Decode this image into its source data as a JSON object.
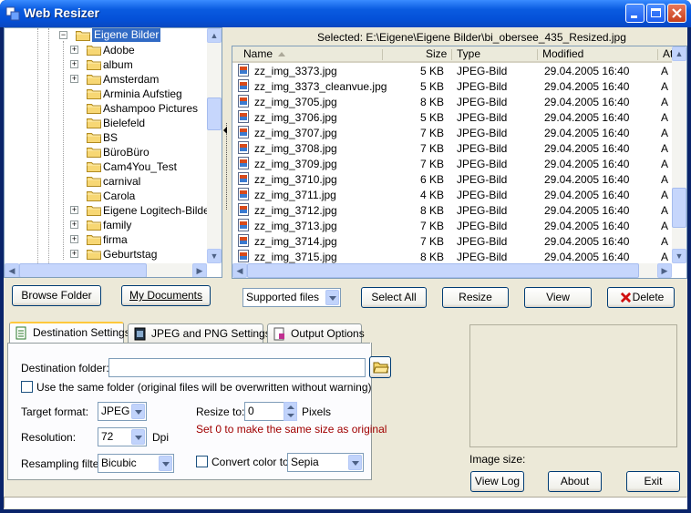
{
  "window": {
    "title": "Web Resizer"
  },
  "selected_path": "Selected: E:\\Eigene\\Eigene Bilder\\bi_obersee_435_Resized.jpg",
  "tree": {
    "items": [
      {
        "label": "Eigene Bilder",
        "expander": "−",
        "selected": true
      },
      {
        "label": "Adobe",
        "expander": "+"
      },
      {
        "label": "album",
        "expander": "+"
      },
      {
        "label": "Amsterdam",
        "expander": "+"
      },
      {
        "label": "Arminia Aufstieg",
        "expander": ""
      },
      {
        "label": "Ashampoo Pictures",
        "expander": ""
      },
      {
        "label": "Bielefeld",
        "expander": ""
      },
      {
        "label": "BS",
        "expander": ""
      },
      {
        "label": "BüroBüro",
        "expander": ""
      },
      {
        "label": "Cam4You_Test",
        "expander": ""
      },
      {
        "label": "carnival",
        "expander": ""
      },
      {
        "label": "Carola",
        "expander": ""
      },
      {
        "label": "Eigene Logitech-Bilder",
        "expander": "+"
      },
      {
        "label": "family",
        "expander": "+"
      },
      {
        "label": "firma",
        "expander": "+"
      },
      {
        "label": "Geburtstag",
        "expander": "+"
      }
    ]
  },
  "file_list": {
    "columns": [
      "Name",
      "Size",
      "Type",
      "Modified",
      "At"
    ],
    "rows": [
      [
        "zz_img_3373.jpg",
        "5 KB",
        "JPEG-Bild",
        "29.04.2005 16:40",
        "A"
      ],
      [
        "zz_img_3373_cleanvue.jpg",
        "5 KB",
        "JPEG-Bild",
        "29.04.2005 16:40",
        "A"
      ],
      [
        "zz_img_3705.jpg",
        "8 KB",
        "JPEG-Bild",
        "29.04.2005 16:40",
        "A"
      ],
      [
        "zz_img_3706.jpg",
        "5 KB",
        "JPEG-Bild",
        "29.04.2005 16:40",
        "A"
      ],
      [
        "zz_img_3707.jpg",
        "7 KB",
        "JPEG-Bild",
        "29.04.2005 16:40",
        "A"
      ],
      [
        "zz_img_3708.jpg",
        "7 KB",
        "JPEG-Bild",
        "29.04.2005 16:40",
        "A"
      ],
      [
        "zz_img_3709.jpg",
        "7 KB",
        "JPEG-Bild",
        "29.04.2005 16:40",
        "A"
      ],
      [
        "zz_img_3710.jpg",
        "6 KB",
        "JPEG-Bild",
        "29.04.2005 16:40",
        "A"
      ],
      [
        "zz_img_3711.jpg",
        "4 KB",
        "JPEG-Bild",
        "29.04.2005 16:40",
        "A"
      ],
      [
        "zz_img_3712.jpg",
        "8 KB",
        "JPEG-Bild",
        "29.04.2005 16:40",
        "A"
      ],
      [
        "zz_img_3713.jpg",
        "7 KB",
        "JPEG-Bild",
        "29.04.2005 16:40",
        "A"
      ],
      [
        "zz_img_3714.jpg",
        "7 KB",
        "JPEG-Bild",
        "29.04.2005 16:40",
        "A"
      ],
      [
        "zz_img_3715.jpg",
        "8 KB",
        "JPEG-Bild",
        "29.04.2005 16:40",
        "A"
      ]
    ]
  },
  "buttons": {
    "browse_folder": "Browse Folder",
    "my_documents": "My Documents",
    "select_all": "Select All",
    "resize": "Resize",
    "view": "View",
    "delete": "Delete",
    "view_log": "View Log",
    "about": "About",
    "exit": "Exit"
  },
  "filter_combo": "Supported files",
  "tabs": [
    "Destination Settings",
    "JPEG and PNG Settings",
    "Output Options"
  ],
  "settings": {
    "destination_label": "Destination folder:",
    "destination_value": "",
    "same_folder_label": "Use the same folder (original files will be overwritten without warning)",
    "target_format_label": "Target format:",
    "target_format_value": "JPEG",
    "resolution_label": "Resolution:",
    "resolution_value": "72",
    "dpi": "Dpi",
    "resampling_label": "Resampling filter:",
    "resampling_value": "Bicubic",
    "resize_to_label": "Resize to:",
    "resize_to_value": "0",
    "pixels": "Pixels",
    "hint": "Set 0 to make the same size as original",
    "convert_color_label": "Convert color to:",
    "convert_color_value": "Sepia"
  },
  "preview": {
    "image_size_label": "Image size:"
  },
  "colors": {
    "hint": "#a00000",
    "title_bar": "#0451d8",
    "selection": "#316ac5"
  }
}
